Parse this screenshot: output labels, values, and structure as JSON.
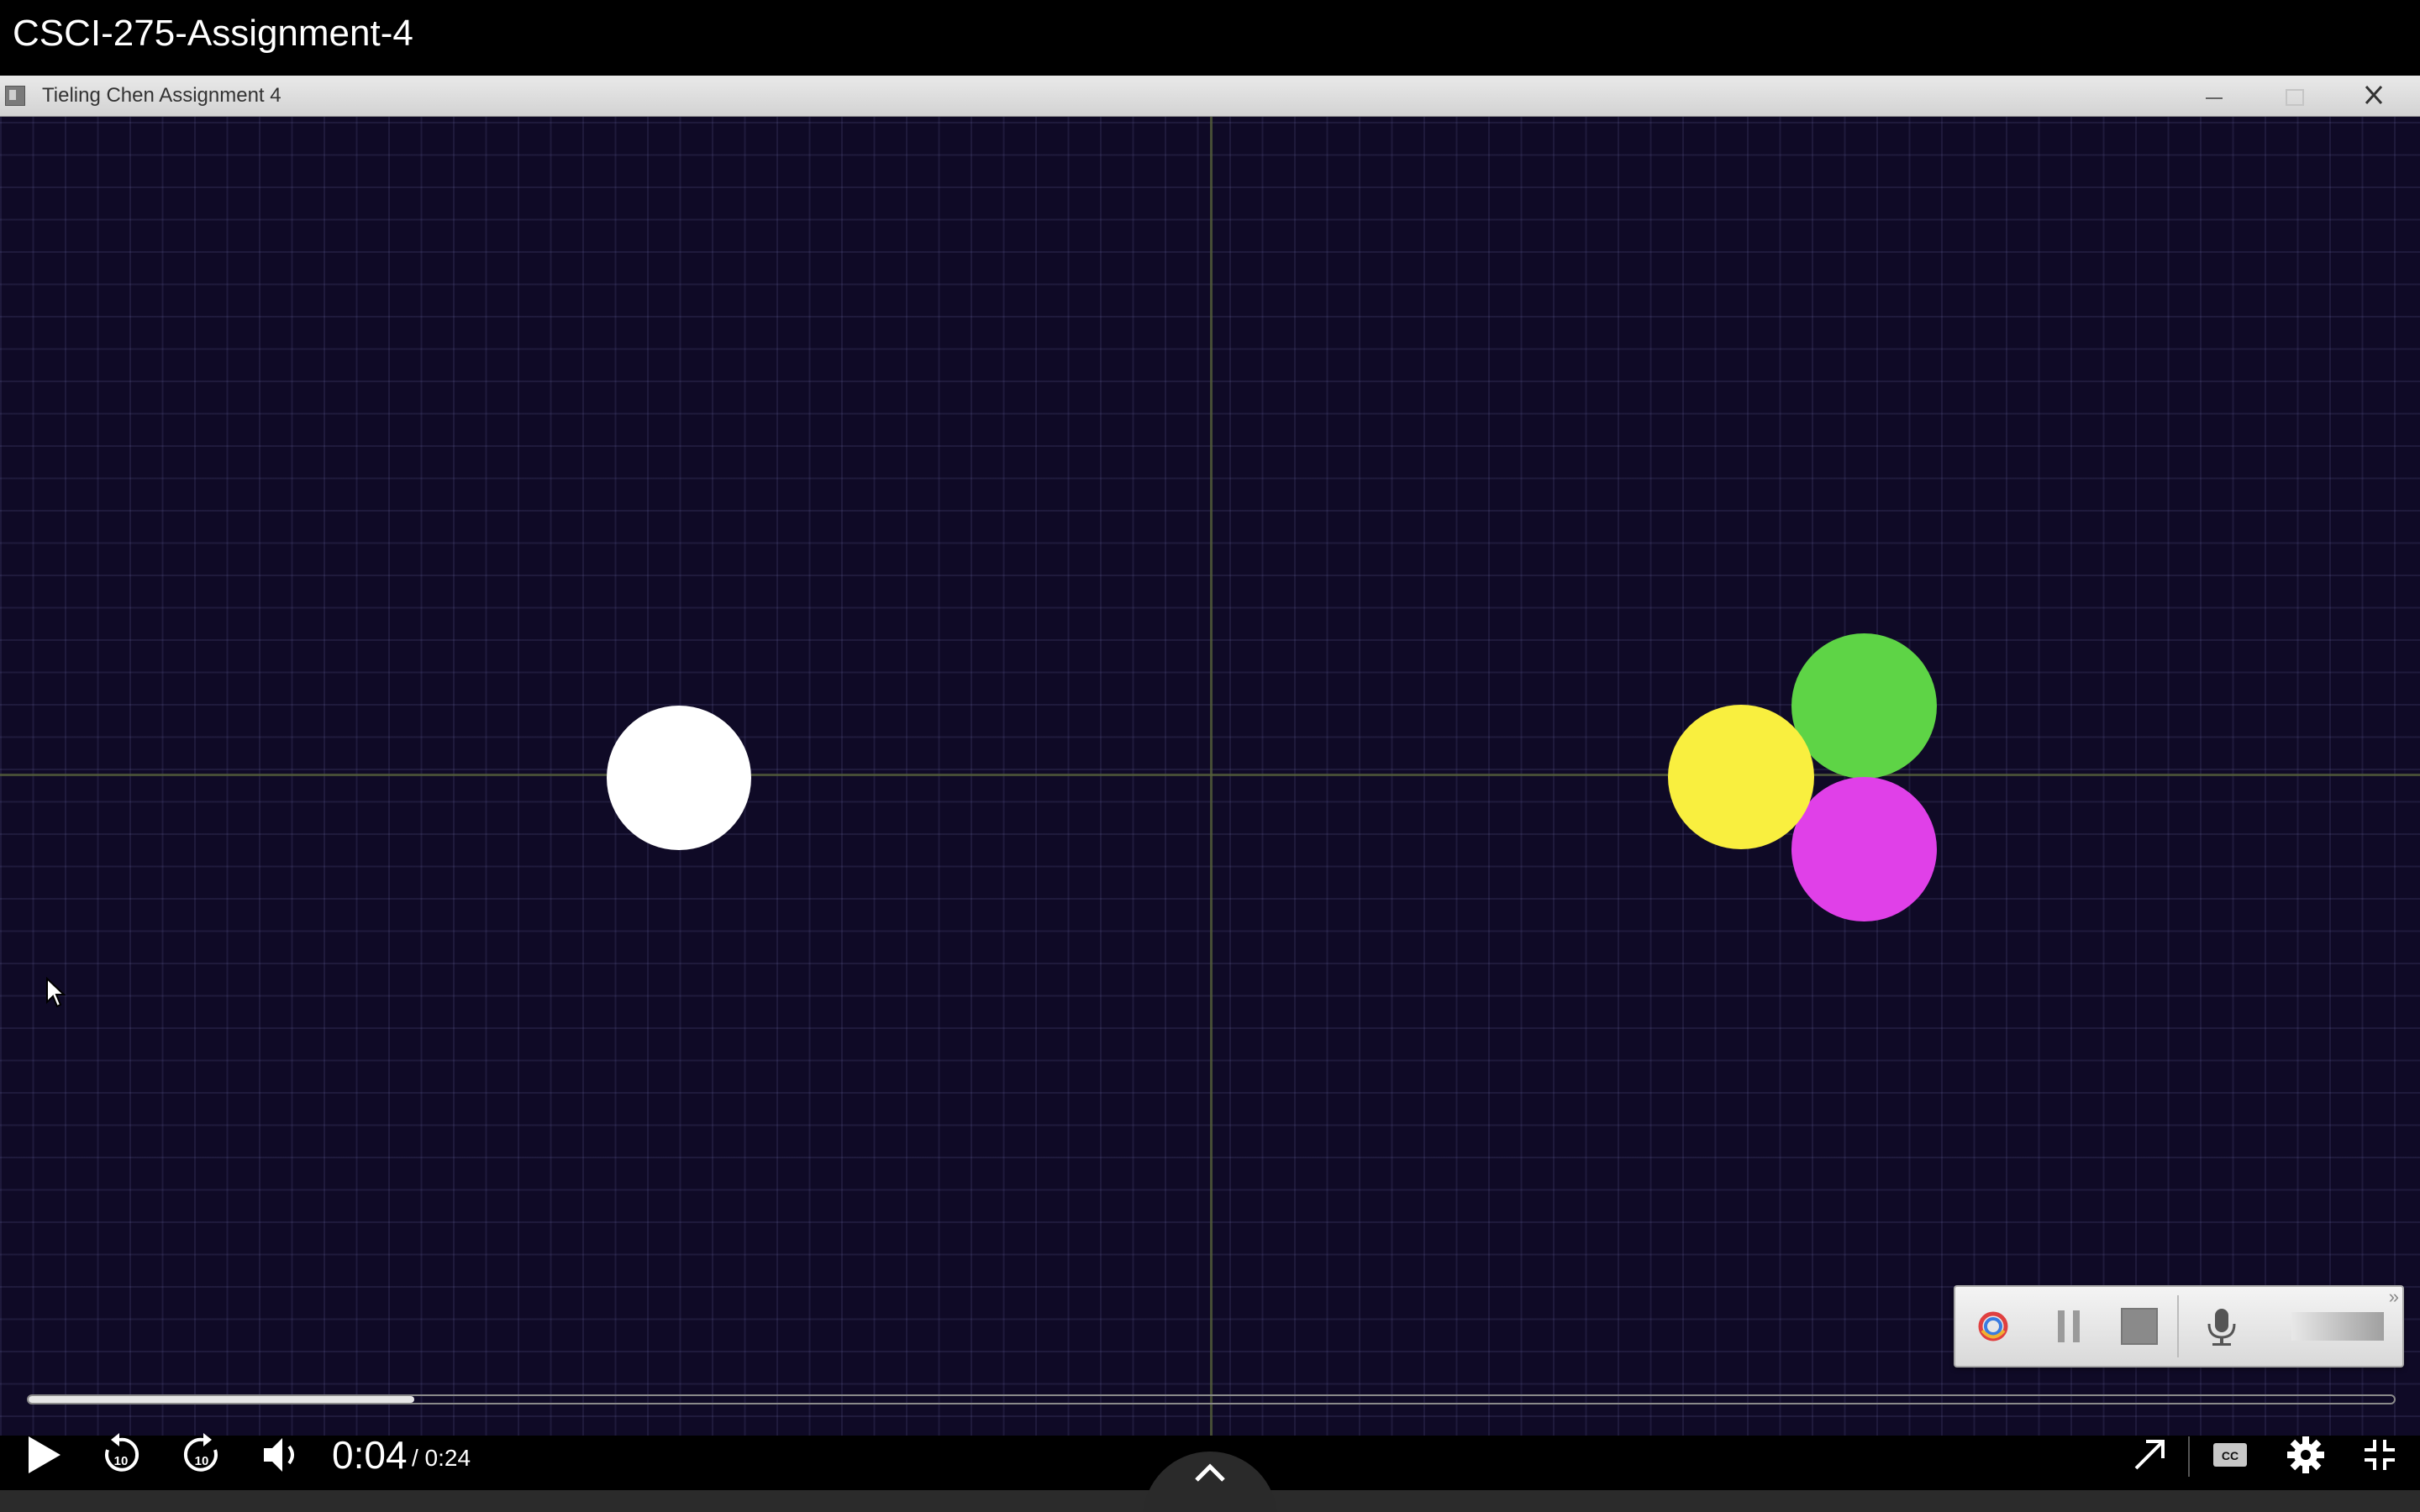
{
  "player": {
    "title": "CSCI-275-Assignment-4",
    "time_current": "0:04",
    "time_total": "/ 0:24",
    "progress_fraction": 0.163
  },
  "window": {
    "title": "Tieling Chen Assignment 4"
  },
  "scene": {
    "background": "#0f0a26",
    "ball_colors": {
      "white": "#ffffff",
      "yellow": "#f9ef3f",
      "green": "#5ed446",
      "magenta": "#e040e8"
    }
  },
  "icons": {
    "play": "play-icon",
    "rewind": "rewind-10-icon",
    "forward": "forward-10-icon",
    "volume": "volume-icon",
    "share": "share-arrow-icon",
    "captions": "cc-icon",
    "settings": "gear-icon",
    "fullscreen": "exit-fullscreen-icon",
    "expand": "chevron-up-icon"
  },
  "recorder": {
    "expand_glyph": "»"
  }
}
